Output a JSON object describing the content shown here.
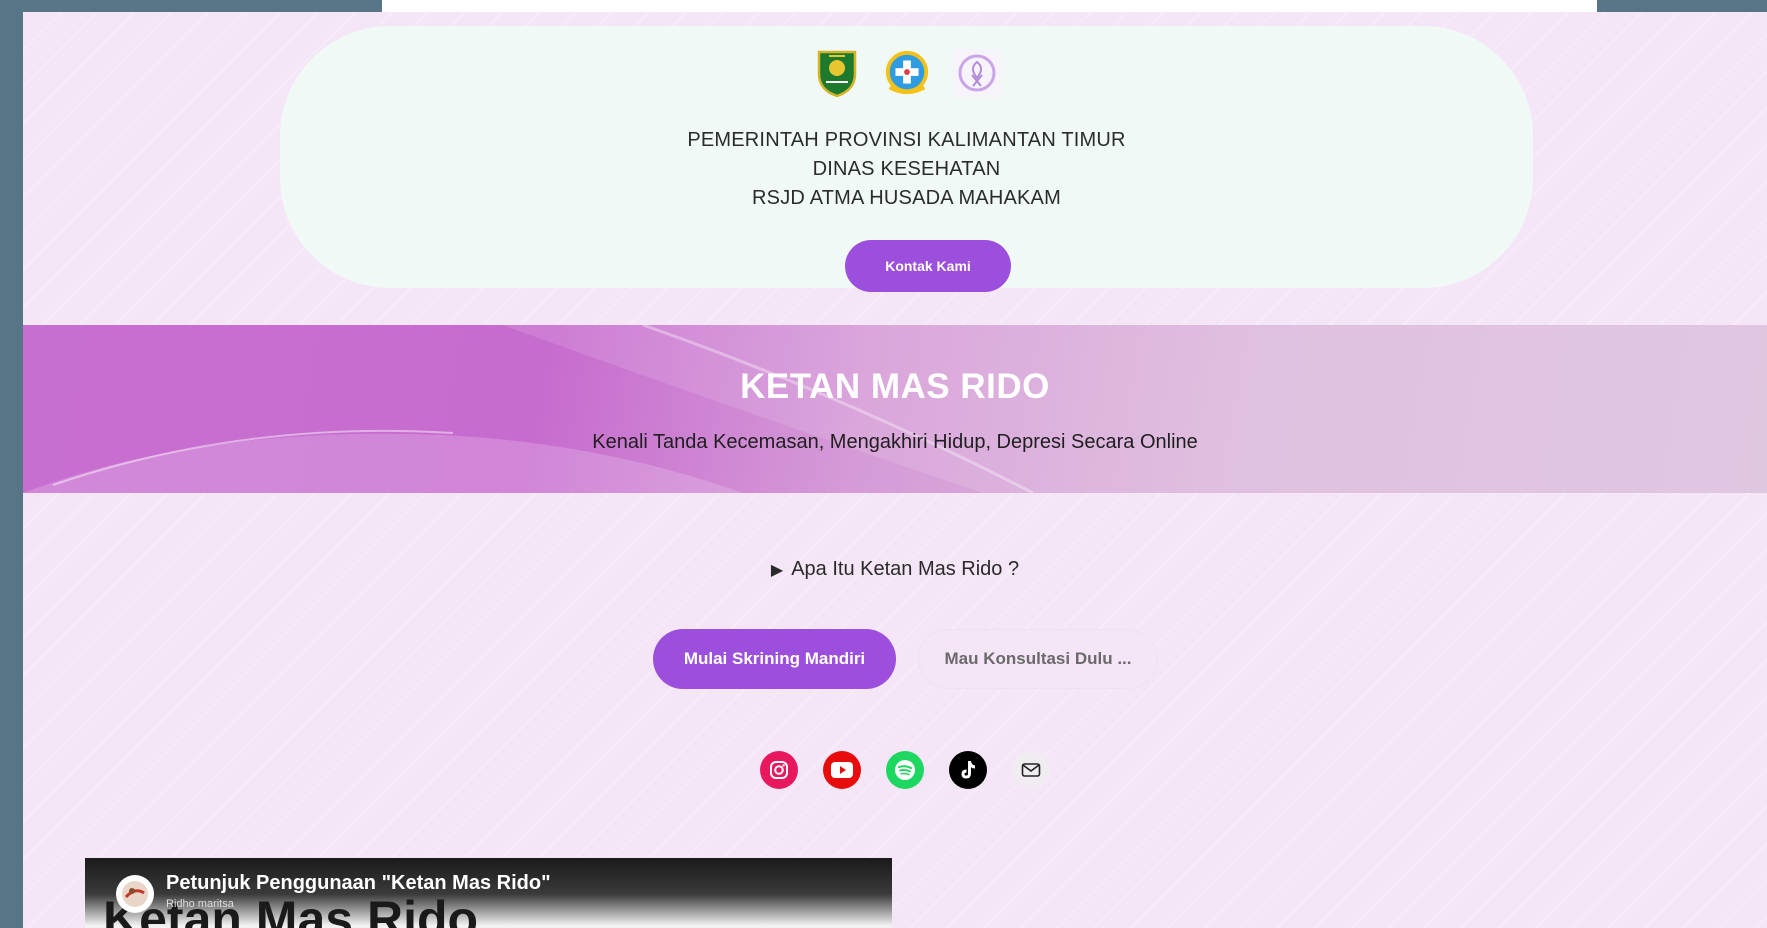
{
  "header": {
    "logos": [
      "provincial-shield-logo",
      "health-department-logo",
      "ribbon-logo"
    ],
    "org_lines": [
      "PEMERINTAH PROVINSI KALIMANTAN TIMUR",
      "DINAS KESEHATAN",
      "RSJD ATMA HUSADA MAHAKAM"
    ],
    "contact_button": "Kontak Kami"
  },
  "hero": {
    "title": "KETAN MAS RIDO",
    "subtitle": "Kenali Tanda Kecemasan, Mengakhiri Hidup, Depresi Secara Online"
  },
  "main": {
    "details_marker": "▶",
    "details_label": "Apa Itu Ketan Mas Rido ?",
    "primary_button": "Mulai Skrining Mandiri",
    "secondary_button": "Mau Konsultasi Dulu ...",
    "social_icons": [
      "instagram-icon",
      "youtube-icon",
      "spotify-icon",
      "tiktok-icon",
      "mail-icon"
    ]
  },
  "video": {
    "title": "Petunjuk Penggunaan \"Ketan Mas Rido\"",
    "channel": "Ridho maritsa",
    "thumbnail_text": "Ketan Mas Rido"
  },
  "colors": {
    "primary": "#9c4fdc",
    "page_background": "#f4e6f6",
    "header_card": "#f1f9f7",
    "outer_background": "#587587"
  }
}
